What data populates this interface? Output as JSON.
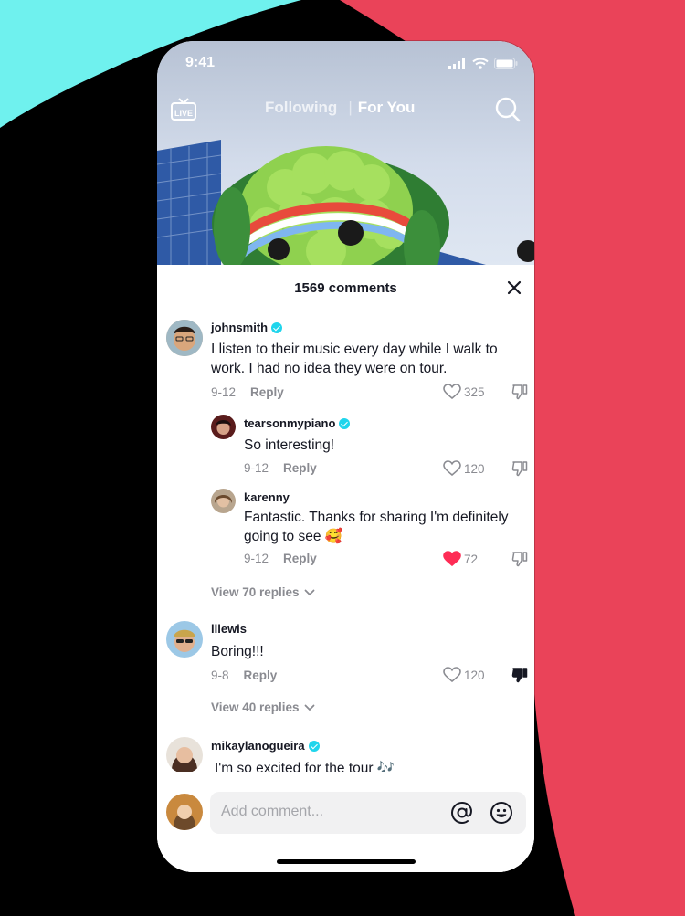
{
  "status": {
    "time": "9:41"
  },
  "nav": {
    "live_label": "LIVE",
    "tab_following": "Following",
    "tab_foryou": "For You"
  },
  "comments_header": {
    "count_label": "1569 comments"
  },
  "comments": [
    {
      "username": "johnsmith",
      "verified": true,
      "text": "I listen to their music every day while I walk to work. I had no idea they were on tour.",
      "date": "9-12",
      "reply_label": "Reply",
      "likes": "325",
      "liked": false,
      "disliked": false
    },
    {
      "username": "tearsonmypiano",
      "verified": true,
      "text": "So interesting!",
      "date": "9-12",
      "reply_label": "Reply",
      "likes": "120",
      "liked": false,
      "disliked": false
    },
    {
      "username": "karenny",
      "verified": false,
      "text": "Fantastic. Thanks for sharing I'm definitely going to see 🥰",
      "date": "9-12",
      "reply_label": "Reply",
      "likes": "72",
      "liked": true,
      "disliked": false
    },
    {
      "username": "lllewis",
      "verified": false,
      "text": "Boring!!!",
      "date": "9-8",
      "reply_label": "Reply",
      "likes": "120",
      "liked": false,
      "disliked": true
    },
    {
      "username": "mikaylanogueira",
      "verified": true,
      "text": "I'm so excited for the tour 🎶",
      "date": "",
      "reply_label": "",
      "likes": "",
      "liked": false,
      "disliked": false
    }
  ],
  "view_replies": [
    {
      "label": "View 70 replies"
    },
    {
      "label": "View 40 replies"
    }
  ],
  "input": {
    "placeholder": "Add comment..."
  },
  "colors": {
    "brand_cyan": "#6ff1ee",
    "brand_red": "#ea4359",
    "like_red": "#fe2c55",
    "verified": "#20d5ec"
  }
}
